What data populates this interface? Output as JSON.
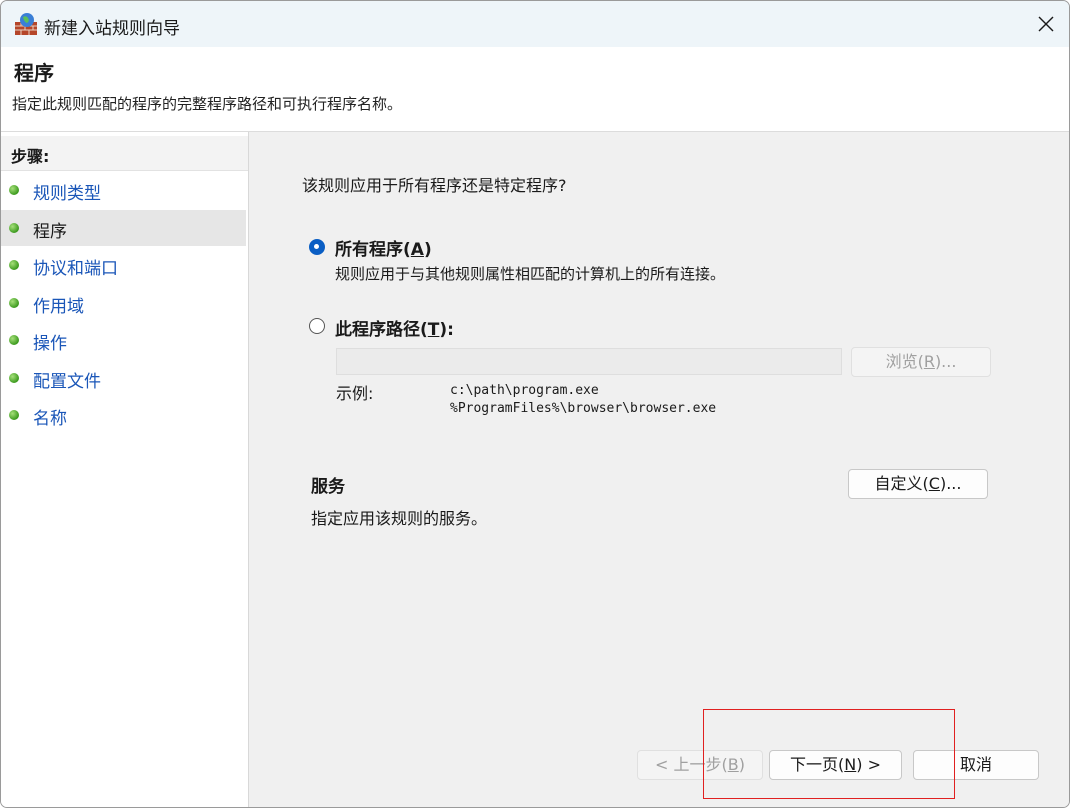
{
  "window": {
    "title": "新建入站规则向导",
    "app_icon": "firewall-icon",
    "close_icon": "close-icon"
  },
  "header": {
    "title": "程序",
    "description": "指定此规则匹配的程序的完整程序路径和可执行程序名称。"
  },
  "steps": {
    "header": "步骤:",
    "items": [
      {
        "label": "规则类型",
        "selected": false
      },
      {
        "label": "程序",
        "selected": true
      },
      {
        "label": "协议和端口",
        "selected": false
      },
      {
        "label": "作用域",
        "selected": false
      },
      {
        "label": "操作",
        "selected": false
      },
      {
        "label": "配置文件",
        "selected": false
      },
      {
        "label": "名称",
        "selected": false
      }
    ]
  },
  "content": {
    "question": "该规则应用于所有程序还是特定程序?",
    "all_programs": {
      "label_prefix": "所有程序(",
      "accel": "A",
      "label_suffix": ")",
      "description": "规则应用于与其他规则属性相匹配的计算机上的所有连接。",
      "checked": true
    },
    "this_program": {
      "label_prefix": "此程序路径(",
      "accel": "T",
      "label_suffix": "):",
      "checked": false,
      "path_value": ""
    },
    "browse_button": {
      "prefix": "浏览(",
      "accel": "R",
      "suffix": ")..."
    },
    "example_label": "示例:",
    "example_lines": [
      "c:\\path\\program.exe",
      "%ProgramFiles%\\browser\\browser.exe"
    ],
    "services": {
      "title": "服务",
      "description": "指定应用该规则的服务。",
      "customize_button": {
        "prefix": "自定义(",
        "accel": "C",
        "suffix": ")..."
      }
    }
  },
  "footer": {
    "back_button": {
      "prefix": "< 上一步(",
      "accel": "B",
      "suffix": ")"
    },
    "next_button": {
      "prefix": "下一页(",
      "accel": "N",
      "suffix": ") >"
    },
    "cancel_button": "取消"
  },
  "colors": {
    "accent": "#0a5ec4",
    "link": "#1a56b8",
    "highlight": "#e02020"
  }
}
